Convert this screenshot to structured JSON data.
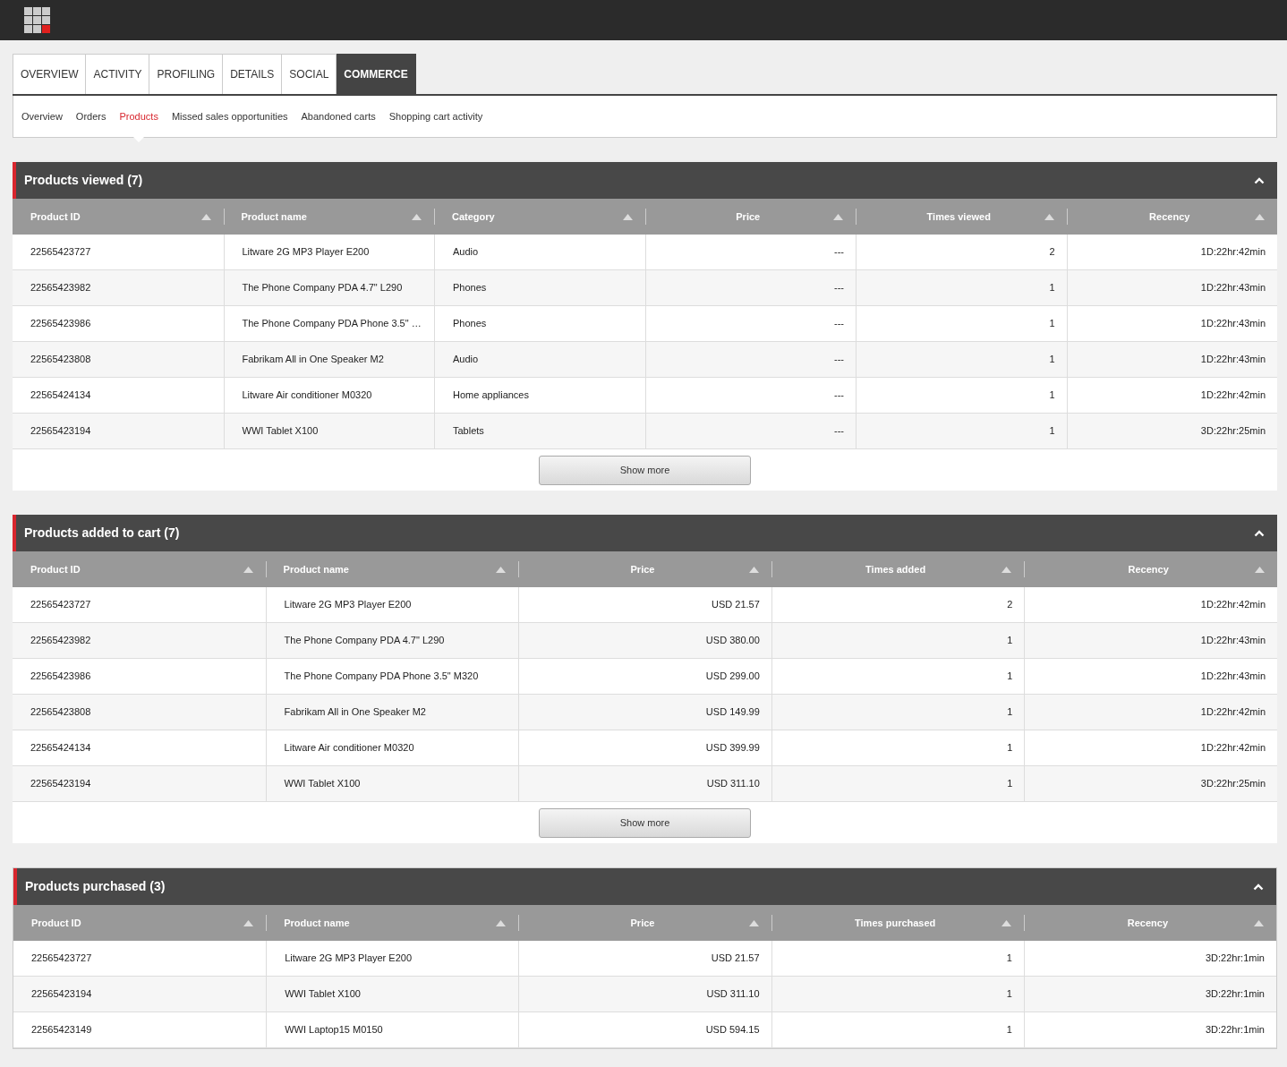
{
  "tabs": [
    {
      "label": "OVERVIEW",
      "selected": false
    },
    {
      "label": "ACTIVITY",
      "selected": false
    },
    {
      "label": "PROFILING",
      "selected": false
    },
    {
      "label": "DETAILS",
      "selected": false
    },
    {
      "label": "SOCIAL",
      "selected": false
    },
    {
      "label": "COMMERCE",
      "selected": true
    }
  ],
  "subtabs": [
    {
      "label": "Overview",
      "selected": false
    },
    {
      "label": "Orders",
      "selected": false
    },
    {
      "label": "Products",
      "selected": true
    },
    {
      "label": "Missed sales opportunities",
      "selected": false
    },
    {
      "label": "Abandoned carts",
      "selected": false
    },
    {
      "label": "Shopping cart activity",
      "selected": false
    }
  ],
  "sections": [
    {
      "title": "Products viewed (7)",
      "expanded": true,
      "show_more": "Show more",
      "columns": [
        {
          "label": "Product ID",
          "kind": "text"
        },
        {
          "label": "Product name",
          "kind": "text"
        },
        {
          "label": "Category",
          "kind": "text"
        },
        {
          "label": "Price",
          "kind": "number"
        },
        {
          "label": "Times viewed",
          "kind": "number"
        },
        {
          "label": "Recency",
          "kind": "number"
        }
      ],
      "rows": [
        [
          "22565423727",
          "Litware 2G MP3 Player E200",
          "Audio",
          "---",
          "2",
          "1D:22hr:42min"
        ],
        [
          "22565423982",
          "The Phone Company PDA 4.7\" L290",
          "Phones",
          "---",
          "1",
          "1D:22hr:43min"
        ],
        [
          "22565423986",
          "The Phone Company PDA Phone 3.5\" …",
          "Phones",
          "---",
          "1",
          "1D:22hr:43min"
        ],
        [
          "22565423808",
          "Fabrikam All in One Speaker M2",
          "Audio",
          "---",
          "1",
          "1D:22hr:43min"
        ],
        [
          "22565424134",
          "Litware Air conditioner M0320",
          "Home appliances",
          "---",
          "1",
          "1D:22hr:42min"
        ],
        [
          "22565423194",
          "WWI Tablet X100",
          "Tablets",
          "---",
          "1",
          "3D:22hr:25min"
        ]
      ]
    },
    {
      "title": "Products added to cart (7)",
      "expanded": true,
      "show_more": "Show more",
      "columns": [
        {
          "label": "Product ID",
          "kind": "text"
        },
        {
          "label": "Product name",
          "kind": "text"
        },
        {
          "label": "Price",
          "kind": "number"
        },
        {
          "label": "Times added",
          "kind": "number"
        },
        {
          "label": "Recency",
          "kind": "number"
        }
      ],
      "rows": [
        [
          "22565423727",
          "Litware 2G MP3 Player E200",
          "USD 21.57",
          "2",
          "1D:22hr:42min"
        ],
        [
          "22565423982",
          "The Phone Company PDA 4.7\" L290",
          "USD 380.00",
          "1",
          "1D:22hr:43min"
        ],
        [
          "22565423986",
          "The Phone Company PDA Phone 3.5\" M320",
          "USD 299.00",
          "1",
          "1D:22hr:43min"
        ],
        [
          "22565423808",
          "Fabrikam All in One Speaker M2",
          "USD 149.99",
          "1",
          "1D:22hr:42min"
        ],
        [
          "22565424134",
          "Litware Air conditioner M0320",
          "USD 399.99",
          "1",
          "1D:22hr:42min"
        ],
        [
          "22565423194",
          "WWI Tablet X100",
          "USD 311.10",
          "1",
          "3D:22hr:25min"
        ]
      ]
    },
    {
      "title": "Products purchased (3)",
      "expanded": true,
      "columns": [
        {
          "label": "Product ID",
          "kind": "text"
        },
        {
          "label": "Product name",
          "kind": "text"
        },
        {
          "label": "Price",
          "kind": "number"
        },
        {
          "label": "Times purchased",
          "kind": "number"
        },
        {
          "label": "Recency",
          "kind": "number"
        }
      ],
      "rows": [
        [
          "22565423727",
          "Litware 2G MP3 Player E200",
          "USD 21.57",
          "1",
          "3D:22hr:1min"
        ],
        [
          "22565423194",
          "WWI Tablet X100",
          "USD 311.10",
          "1",
          "3D:22hr:1min"
        ],
        [
          "22565423149",
          "WWI Laptop15 M0150",
          "USD 594.15",
          "1",
          "3D:22hr:1min"
        ]
      ]
    }
  ]
}
